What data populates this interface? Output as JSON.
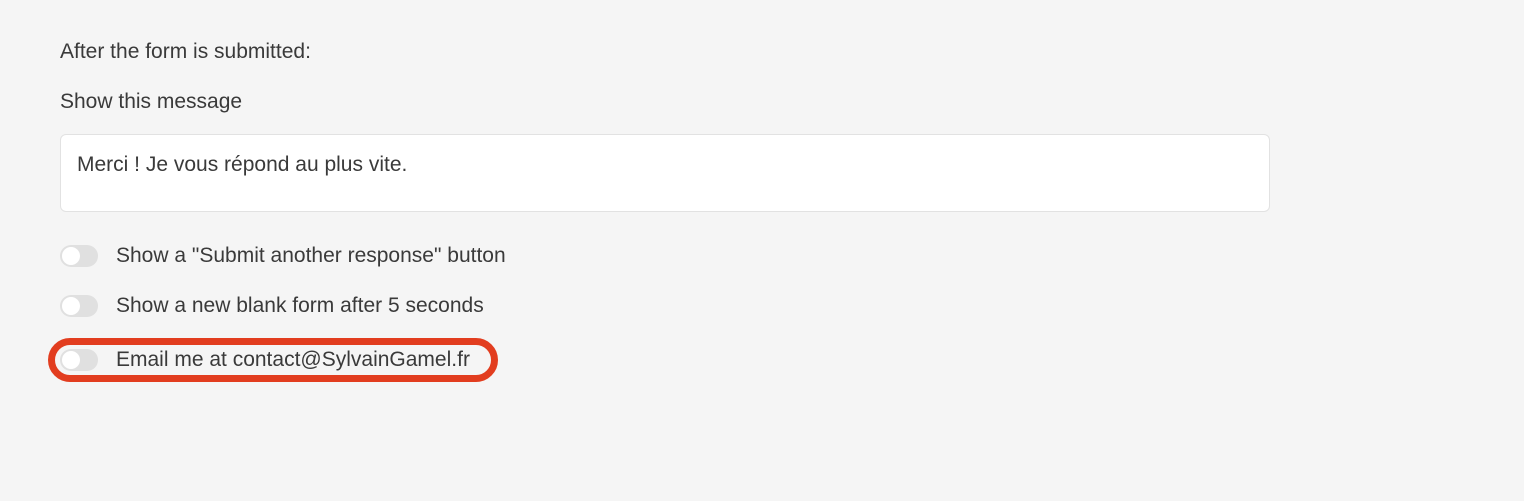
{
  "section": {
    "title": "After the form is submitted:"
  },
  "message_field": {
    "label": "Show this message",
    "value": "Merci ! Je vous répond au plus vite."
  },
  "toggles": {
    "submit_another": {
      "label": "Show a \"Submit another response\" button",
      "enabled": false
    },
    "blank_form": {
      "label": "Show a new blank form after 5 seconds",
      "enabled": false
    },
    "email_me": {
      "label": "Email me at contact@SylvainGamel.fr",
      "enabled": false
    }
  }
}
